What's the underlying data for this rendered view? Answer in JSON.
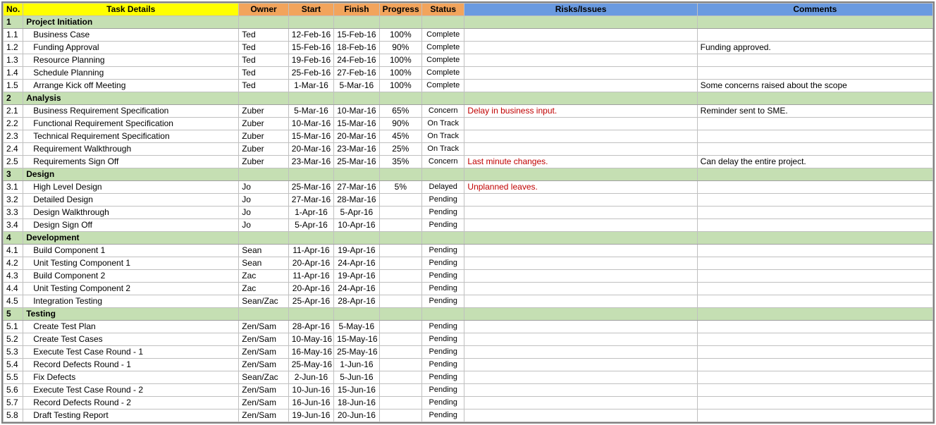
{
  "chart_data": {
    "type": "table",
    "columns": [
      "No.",
      "Task Details",
      "Owner",
      "Start",
      "Finish",
      "Progress",
      "Status",
      "Risks/Issues",
      "Comments"
    ],
    "groups": [
      {
        "num": "1",
        "title": "Project Initiation",
        "rows": [
          {
            "num": "1.1",
            "task": "Business Case",
            "owner": "Ted",
            "start": "12-Feb-16",
            "finish": "15-Feb-16",
            "progress": "100%",
            "status": "Complete",
            "risks": "",
            "comments": ""
          },
          {
            "num": "1.2",
            "task": "Funding Approval",
            "owner": "Ted",
            "start": "15-Feb-16",
            "finish": "18-Feb-16",
            "progress": "90%",
            "status": "Complete",
            "risks": "",
            "comments": "Funding approved."
          },
          {
            "num": "1.3",
            "task": "Resource Planning",
            "owner": "Ted",
            "start": "19-Feb-16",
            "finish": "24-Feb-16",
            "progress": "100%",
            "status": "Complete",
            "risks": "",
            "comments": ""
          },
          {
            "num": "1.4",
            "task": "Schedule Planning",
            "owner": "Ted",
            "start": "25-Feb-16",
            "finish": "27-Feb-16",
            "progress": "100%",
            "status": "Complete",
            "risks": "",
            "comments": ""
          },
          {
            "num": "1.5",
            "task": "Arrange Kick off Meeting",
            "owner": "Ted",
            "start": "1-Mar-16",
            "finish": "5-Mar-16",
            "progress": "100%",
            "status": "Complete",
            "risks": "",
            "comments": "Some concerns raised about the scope"
          }
        ]
      },
      {
        "num": "2",
        "title": "Analysis",
        "rows": [
          {
            "num": "2.1",
            "task": "Business Requirement Specification",
            "owner": "Zuber",
            "start": "5-Mar-16",
            "finish": "10-Mar-16",
            "progress": "65%",
            "status": "Concern",
            "risks": "Delay in business input.",
            "comments": "Reminder sent to SME."
          },
          {
            "num": "2.2",
            "task": "Functional Requirement Specification",
            "owner": "Zuber",
            "start": "10-Mar-16",
            "finish": "15-Mar-16",
            "progress": "90%",
            "status": "On Track",
            "risks": "",
            "comments": ""
          },
          {
            "num": "2.3",
            "task": "Technical Requirement Specification",
            "owner": "Zuber",
            "start": "15-Mar-16",
            "finish": "20-Mar-16",
            "progress": "45%",
            "status": "On Track",
            "risks": "",
            "comments": ""
          },
          {
            "num": "2.4",
            "task": "Requirement Walkthrough",
            "owner": "Zuber",
            "start": "20-Mar-16",
            "finish": "23-Mar-16",
            "progress": "25%",
            "status": "On Track",
            "risks": "",
            "comments": ""
          },
          {
            "num": "2.5",
            "task": "Requirements Sign Off",
            "owner": "Zuber",
            "start": "23-Mar-16",
            "finish": "25-Mar-16",
            "progress": "35%",
            "status": "Concern",
            "risks": "Last minute changes.",
            "comments": "Can delay the entire project."
          }
        ]
      },
      {
        "num": "3",
        "title": "Design",
        "rows": [
          {
            "num": "3.1",
            "task": "High Level Design",
            "owner": "Jo",
            "start": "25-Mar-16",
            "finish": "27-Mar-16",
            "progress": "5%",
            "status": "Delayed",
            "risks": "Unplanned leaves.",
            "comments": ""
          },
          {
            "num": "3.2",
            "task": "Detailed Design",
            "owner": "Jo",
            "start": "27-Mar-16",
            "finish": "28-Mar-16",
            "progress": "",
            "status": "Pending",
            "risks": "",
            "comments": ""
          },
          {
            "num": "3.3",
            "task": "Design Walkthrough",
            "owner": "Jo",
            "start": "1-Apr-16",
            "finish": "5-Apr-16",
            "progress": "",
            "status": "Pending",
            "risks": "",
            "comments": ""
          },
          {
            "num": "3.4",
            "task": "Design Sign Off",
            "owner": "Jo",
            "start": "5-Apr-16",
            "finish": "10-Apr-16",
            "progress": "",
            "status": "Pending",
            "risks": "",
            "comments": ""
          }
        ]
      },
      {
        "num": "4",
        "title": "Development",
        "rows": [
          {
            "num": "4.1",
            "task": "Build Component 1",
            "owner": "Sean",
            "start": "11-Apr-16",
            "finish": "19-Apr-16",
            "progress": "",
            "status": "Pending",
            "risks": "",
            "comments": ""
          },
          {
            "num": "4.2",
            "task": "Unit Testing Component 1",
            "owner": "Sean",
            "start": "20-Apr-16",
            "finish": "24-Apr-16",
            "progress": "",
            "status": "Pending",
            "risks": "",
            "comments": ""
          },
          {
            "num": "4.3",
            "task": "Build Component 2",
            "owner": "Zac",
            "start": "11-Apr-16",
            "finish": "19-Apr-16",
            "progress": "",
            "status": "Pending",
            "risks": "",
            "comments": ""
          },
          {
            "num": "4.4",
            "task": "Unit Testing Component 2",
            "owner": "Zac",
            "start": "20-Apr-16",
            "finish": "24-Apr-16",
            "progress": "",
            "status": "Pending",
            "risks": "",
            "comments": ""
          },
          {
            "num": "4.5",
            "task": "Integration Testing",
            "owner": "Sean/Zac",
            "start": "25-Apr-16",
            "finish": "28-Apr-16",
            "progress": "",
            "status": "Pending",
            "risks": "",
            "comments": ""
          }
        ]
      },
      {
        "num": "5",
        "title": "Testing",
        "rows": [
          {
            "num": "5.1",
            "task": "Create Test Plan",
            "owner": "Zen/Sam",
            "start": "28-Apr-16",
            "finish": "5-May-16",
            "progress": "",
            "status": "Pending",
            "risks": "",
            "comments": ""
          },
          {
            "num": "5.2",
            "task": "Create Test Cases",
            "owner": "Zen/Sam",
            "start": "10-May-16",
            "finish": "15-May-16",
            "progress": "",
            "status": "Pending",
            "risks": "",
            "comments": ""
          },
          {
            "num": "5.3",
            "task": "Execute Test Case Round - 1",
            "owner": "Zen/Sam",
            "start": "16-May-16",
            "finish": "25-May-16",
            "progress": "",
            "status": "Pending",
            "risks": "",
            "comments": ""
          },
          {
            "num": "5.4",
            "task": "Record Defects Round - 1",
            "owner": "Zen/Sam",
            "start": "25-May-16",
            "finish": "1-Jun-16",
            "progress": "",
            "status": "Pending",
            "risks": "",
            "comments": ""
          },
          {
            "num": "5.5",
            "task": "Fix Defects",
            "owner": "Sean/Zac",
            "start": "2-Jun-16",
            "finish": "5-Jun-16",
            "progress": "",
            "status": "Pending",
            "risks": "",
            "comments": ""
          },
          {
            "num": "5.6",
            "task": "Execute Test Case Round - 2",
            "owner": "Zen/Sam",
            "start": "10-Jun-16",
            "finish": "15-Jun-16",
            "progress": "",
            "status": "Pending",
            "risks": "",
            "comments": ""
          },
          {
            "num": "5.7",
            "task": "Record Defects Round - 2",
            "owner": "Zen/Sam",
            "start": "16-Jun-16",
            "finish": "18-Jun-16",
            "progress": "",
            "status": "Pending",
            "risks": "",
            "comments": ""
          },
          {
            "num": "5.8",
            "task": "Draft Testing Report",
            "owner": "Zen/Sam",
            "start": "19-Jun-16",
            "finish": "20-Jun-16",
            "progress": "",
            "status": "Pending",
            "risks": "",
            "comments": ""
          }
        ]
      }
    ]
  },
  "headers": {
    "no": "No.",
    "task": "Task Details",
    "owner": "Owner",
    "start": "Start",
    "finish": "Finish",
    "progress": "Progress",
    "status": "Status",
    "risks": "Risks/Issues",
    "comments": "Comments"
  }
}
